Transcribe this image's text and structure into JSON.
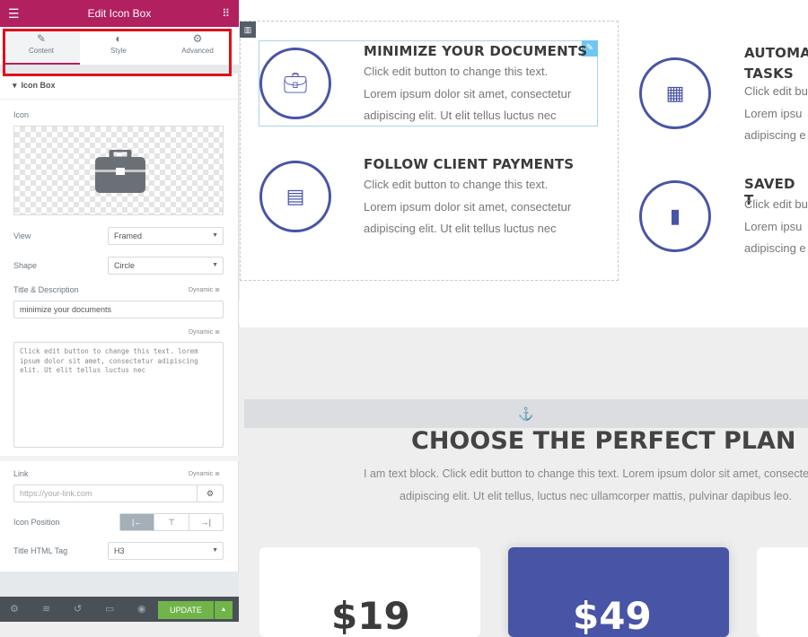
{
  "panel": {
    "title": "Edit Icon Box",
    "tabs": [
      {
        "label": "Content",
        "icon": "pencil-icon",
        "active": true
      },
      {
        "label": "Style",
        "icon": "half-circle-icon"
      },
      {
        "label": "Advanced",
        "icon": "gear-icon"
      }
    ],
    "section_title": "Icon Box",
    "icon_label": "Icon",
    "view_label": "View",
    "view_value": "Framed",
    "shape_label": "Shape",
    "shape_value": "Circle",
    "title_desc_label": "Title & Description",
    "dynamic": "Dynamic",
    "title_value": "minimize your documents",
    "description_value": "Click edit button to change this text. lorem ipsum dolor sit amet, consectetur adipiscing elit. Ut elit tellus luctus nec",
    "link_label": "Link",
    "link_placeholder": "https://your-link.com",
    "icon_position_label": "Icon Position",
    "icon_position_active": "left",
    "title_tag_label": "Title HTML Tag",
    "title_tag_value": "H3",
    "update_label": "UPDATE",
    "accent": "#b2205f",
    "update_color": "#71b44a"
  },
  "canvas": {
    "boxes": [
      {
        "title": "MINIMIZE YOUR DOCUMENTS",
        "icon": "briefcase-icon",
        "text": [
          "Click edit button to change this text.",
          "Lorem ipsum dolor sit amet, consectetur",
          "adipiscing elit. Ut elit tellus luctus nec"
        ]
      },
      {
        "title": "FOLLOW CLIENT PAYMENTS",
        "icon": "credit-card-icon",
        "text": [
          "Click edit button to change this text.",
          "Lorem ipsum dolor sit amet, consectetur",
          "adipiscing elit. Ut elit tellus luctus nec"
        ]
      },
      {
        "title": "AUTOMA",
        "title2": "TASKS",
        "icon": "calculator-icon",
        "text": [
          "Click edit bu",
          "Lorem ipsu",
          "adipiscing e"
        ]
      },
      {
        "title": "SAVED T",
        "icon": "book-icon",
        "text": [
          "Click edit bu",
          "Lorem ipsu",
          "adipiscing e"
        ]
      }
    ],
    "pricing_heading": "CHOOSE THE PERFECT PLAN",
    "pricing_text": [
      "I am text block. Click edit button to change this text. Lorem ipsum dolor sit amet, consectetur",
      "adipiscing elit. Ut elit tellus, luctus nec ullamcorper mattis, pulvinar dapibus leo."
    ],
    "prices": [
      "$19",
      "$49"
    ],
    "brand_color": "#4854a6"
  }
}
